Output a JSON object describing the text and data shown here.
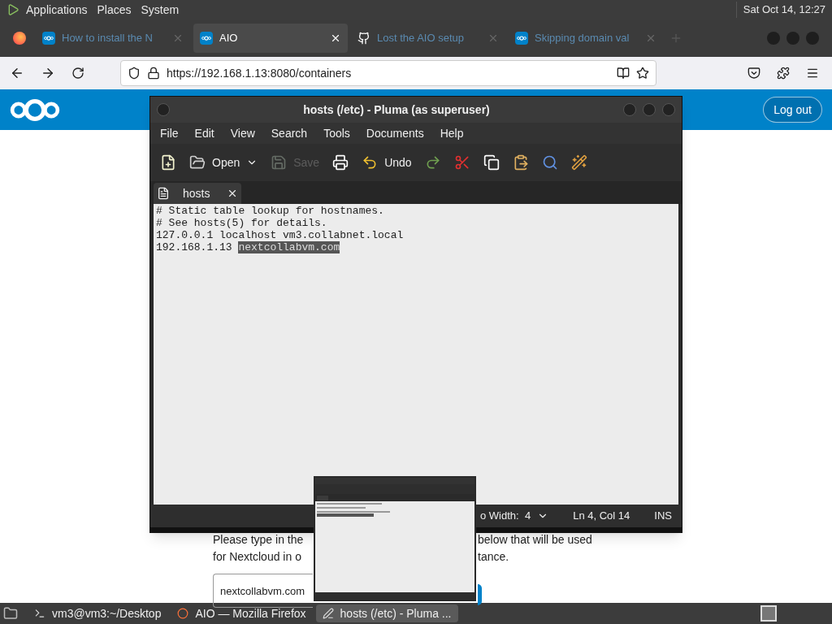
{
  "top_panel": {
    "menus": [
      "Applications",
      "Places",
      "System"
    ],
    "clock": "Sat Oct 14, 12:27"
  },
  "browser": {
    "tabs": [
      {
        "kind": "nextcloud",
        "title": "How to install the N",
        "selected": false
      },
      {
        "kind": "nextcloud",
        "title": "AIO",
        "selected": true
      },
      {
        "kind": "github",
        "title": "Lost the AIO setup",
        "selected": false
      },
      {
        "kind": "nextcloud",
        "title": "Skipping domain val",
        "selected": false
      }
    ],
    "url": "https://192.168.1.13:8080/containers"
  },
  "page": {
    "logout": "Log out",
    "line_1_left": "Please type in the",
    "line_1_right": "below that will be used",
    "line_2_left": "for Nextcloud in o",
    "line_2_right": "tance.",
    "domain_value": "nextcollabvm.com"
  },
  "editor": {
    "title": "hosts (/etc) - Pluma (as superuser)",
    "menus": [
      "File",
      "Edit",
      "View",
      "Search",
      "Tools",
      "Documents",
      "Help"
    ],
    "toolbar": [
      {
        "kind": "new",
        "disabled": false
      },
      {
        "kind": "open",
        "label": "Open",
        "disabled": false
      },
      {
        "kind": "save",
        "label": "Save",
        "disabled": true
      },
      {
        "kind": "print",
        "disabled": false
      },
      {
        "kind": "undo",
        "label": "Undo",
        "disabled": false
      },
      {
        "kind": "redo",
        "disabled": false
      },
      {
        "kind": "cut",
        "disabled": false
      },
      {
        "kind": "copy",
        "disabled": false
      },
      {
        "kind": "paste",
        "disabled": false
      },
      {
        "kind": "find",
        "disabled": false
      },
      {
        "kind": "replace",
        "disabled": false
      }
    ],
    "tab": "hosts",
    "lines": [
      {
        "text": "# Static table lookup for hostnames."
      },
      {
        "text": "# See hosts(5) for details."
      },
      {
        "text": "127.0.0.1 localhost vm3.collabnet.local"
      },
      {
        "text": "192.168.1.13 ",
        "selected_text": "nextcollabvm.com"
      }
    ],
    "status": {
      "tab_width": "o Width:  4",
      "position": "Ln 4, Col 14",
      "mode": "INS"
    }
  },
  "taskbar": {
    "items": [
      {
        "kind": "terminal",
        "label": "vm3@vm3:~/Desktop",
        "selected": false
      },
      {
        "kind": "firefox",
        "label": "AIO — Mozilla Firefox",
        "selected": false
      },
      {
        "kind": "editor",
        "label": "hosts (/etc) - Pluma ...",
        "selected": true
      }
    ]
  }
}
